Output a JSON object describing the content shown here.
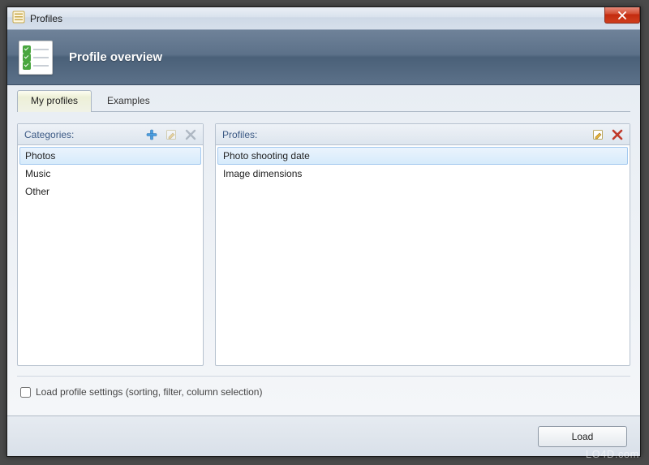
{
  "window": {
    "title": "Profiles"
  },
  "banner": {
    "heading": "Profile overview"
  },
  "tabs": [
    {
      "label": "My profiles",
      "active": true
    },
    {
      "label": "Examples",
      "active": false
    }
  ],
  "categories": {
    "header": "Categories:",
    "items": [
      {
        "label": "Photos",
        "selected": true
      },
      {
        "label": "Music",
        "selected": false
      },
      {
        "label": "Other",
        "selected": false
      }
    ],
    "tools": {
      "add_enabled": true,
      "edit_enabled": false,
      "delete_enabled": false
    }
  },
  "profiles": {
    "header": "Profiles:",
    "items": [
      {
        "label": "Photo shooting date",
        "selected": true
      },
      {
        "label": "Image dimensions",
        "selected": false
      }
    ],
    "tools": {
      "edit_enabled": true,
      "delete_enabled": true
    }
  },
  "checkbox": {
    "label": "Load profile settings (sorting, filter, column selection)",
    "checked": false
  },
  "footer": {
    "load_label": "Load"
  },
  "watermark": "LO4D.com"
}
